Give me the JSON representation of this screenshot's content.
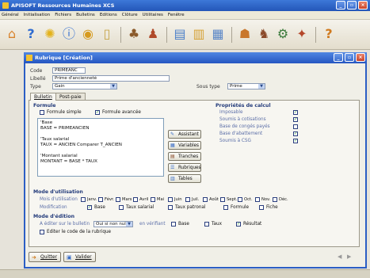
{
  "app": {
    "title": "APISOFT Ressources Humaines XCS"
  },
  "menu": [
    "Général",
    "Initialisation",
    "Fichiers",
    "Bulletins",
    "Editions",
    "Clôture",
    "Utilitaires",
    "Fenêtre"
  ],
  "toolbar_icons": [
    "home-icon",
    "help-icon",
    "bulb-icon",
    "info-icon",
    "coins-icon",
    "book-icon",
    "people-icon",
    "person-icon",
    "folder-icon",
    "folder-open-icon",
    "document-icon",
    "group-icon",
    "team-icon",
    "gear-people-icon",
    "puzzle-icon",
    "help-circle-icon"
  ],
  "dialog": {
    "title": "Rubrique [Création]",
    "code": {
      "label": "Code",
      "value": "PRIMEANC"
    },
    "libelle": {
      "label": "Libellé",
      "value": "Prime d'ancienneté"
    },
    "type": {
      "label": "Type",
      "value": "Gain"
    },
    "sous_type": {
      "label": "Sous type",
      "value": "Prime"
    },
    "tabs": [
      "Bulletin",
      "Post-paie"
    ],
    "formule": {
      "heading": "Formule",
      "simple_label": "Formule simple",
      "avancee_label": "Formule avancée",
      "text": "'Base\nBASE = PRIMEANCIEN\n\n'Taux salarial\nTAUX = ANCIEN Comparer T_ANCIEN\n\n'Montant salarial\nMONTANT = BASE * TAUX"
    },
    "side_buttons": [
      "Assistant",
      "Variables",
      "Tranches",
      "Rubriques",
      "Tables"
    ],
    "proprietes": {
      "heading": "Propriétés de calcul",
      "items": [
        {
          "label": "Imposable",
          "checked": true
        },
        {
          "label": "Soumis à cotisations",
          "checked": true
        },
        {
          "label": "Base de congés payés",
          "checked": false
        },
        {
          "label": "Base d'abattement",
          "checked": true
        },
        {
          "label": "Soumis à CSG",
          "checked": true
        }
      ]
    },
    "utilisation": {
      "heading": "Mode d'utilisation",
      "mois_label": "Mois d'utilisation",
      "months": [
        "Janv.",
        "Févr.",
        "Mars",
        "Avril",
        "Mai",
        "Juin",
        "Juil.",
        "Août",
        "Sept.",
        "Oct.",
        "Nov.",
        "Déc."
      ],
      "modif_label": "Modification",
      "modif_items": [
        {
          "label": "Base",
          "checked": true
        },
        {
          "label": "Taux salarial",
          "checked": false
        },
        {
          "label": "Taux patronal",
          "checked": false
        },
        {
          "label": "Formule",
          "checked": false
        },
        {
          "label": "Fiche",
          "checked": false
        }
      ]
    },
    "edition": {
      "heading": "Mode d'édition",
      "a_editer_label": "A éditer sur le bulletin",
      "select_value": "Oui si non nul",
      "en_verifiant": "en vérifiant",
      "base_label": "Base",
      "taux_label": "Taux",
      "resultat_label": "Résultat",
      "editer_code_label": "Editer le code de la rubrique"
    },
    "buttons": {
      "quitter": "Quitter",
      "valider": "Valider"
    }
  },
  "colors": {
    "title_bar": "#2356b8",
    "section": "#223a7a",
    "check": "#1a8f1a"
  }
}
